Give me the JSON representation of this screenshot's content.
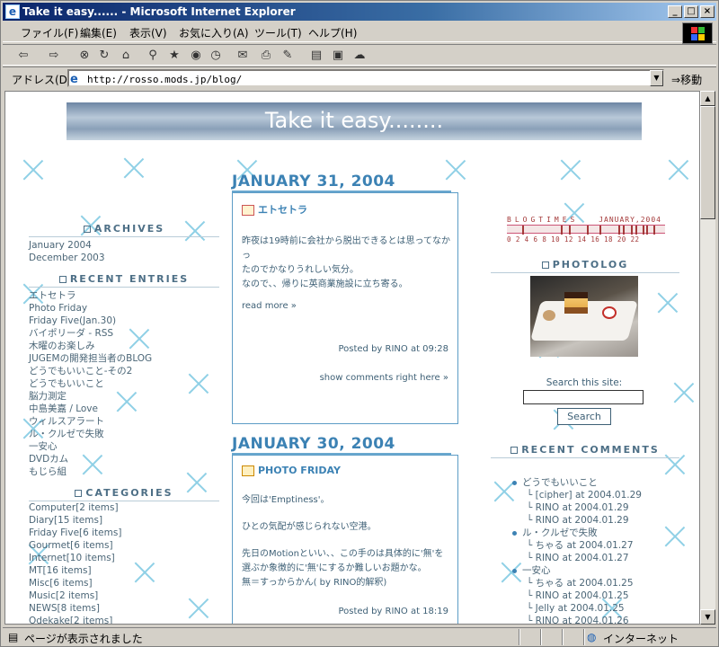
{
  "window": {
    "title": "Take it easy...... - Microsoft Internet Explorer"
  },
  "menu": [
    "ファイル(F)",
    "編集(E)",
    "表示(V)",
    "お気に入り(A)",
    "ツール(T)",
    "ヘルプ(H)"
  ],
  "address": {
    "label": "アドレス(D)",
    "url": "http://rosso.mods.jp/blog/",
    "go": "移動"
  },
  "status": {
    "text": "ページが表示されました",
    "zone": "インターネット"
  },
  "blog": {
    "title": "Take it easy........"
  },
  "sidebar_left": {
    "archives_title": "ARCHIVES",
    "archives": [
      "January 2004",
      "December 2003"
    ],
    "recent_title": "RECENT ENTRIES",
    "recent": [
      "エトセトラ",
      "Photo Friday",
      "Friday Five(Jan.30)",
      "バイポリーダ - RSS",
      "木曜のお楽しみ",
      "JUGEMの開発担当者のBLOG",
      "どうでもいいこと-その2",
      "どうでもいいこと",
      "脳力測定",
      "中島美嘉 / Love",
      "ウィルスアラート",
      "ル・クルゼで失敗",
      "一安心",
      "DVDカム",
      "もじら組"
    ],
    "categories_title": "CATEGORIES",
    "categories": [
      "Computer[2 items]",
      "Diary[15 items]",
      "Friday Five[6 items]",
      "Gourmet[6 items]",
      "Internet[10 items]",
      "MT[16 items]",
      "Misc[6 items]",
      "Music[2 items]",
      "NEWS[8 items]",
      "Odekake[2 items]"
    ]
  },
  "entries": [
    {
      "date": "JANUARY 31, 2004",
      "title": "エトセトラ",
      "body": [
        "昨夜は19時前に会社から脱出できるとは思ってなかっ",
        "たのでかなりうれしい気分。",
        "なので、、帰りに英商業施設に立ち寄る。"
      ],
      "readmore": "read more »",
      "posted": "Posted by RINO at 09:28",
      "comments": "show comments right here »"
    },
    {
      "date": "JANUARY 30, 2004",
      "title": "PHOTO FRIDAY",
      "body": [
        "今回は'Emptiness'。",
        "",
        "ひとの気配が感じられない空港。",
        "",
        "先日のMotionといい、、この手のは具体的に'無'を",
        "選ぶか象徴的に'無'にするか難しいお題かな。",
        "無＝すっからかん( by RINO的解釈)"
      ],
      "posted": "Posted by RINO at 18:19"
    }
  ],
  "sidebar_right": {
    "blogtimes_title": "BLOGTIMES",
    "blogtimes_month": "JANUARY,2004",
    "blogtimes_axis": "0  2  4  6  8  10 12 14 16 18 20 22",
    "blogtimes_posts": [
      0.1,
      0.35,
      0.4,
      0.52,
      0.6,
      0.72,
      0.75,
      0.8,
      0.83,
      0.88,
      0.9,
      0.95
    ],
    "photolog_title": "PHOTOLOG",
    "search_label": "Search this site:",
    "search_button": "Search",
    "recent_comments_title": "RECENT COMMENTS",
    "recent_comments": [
      {
        "entry": "どうでもいいこと",
        "comments": [
          "[cipher] at 2004.01.29",
          "RINO at 2004.01.29",
          "RINO at 2004.01.29"
        ]
      },
      {
        "entry": "ル・クルゼで失敗",
        "comments": [
          "ちゃる at 2004.01.27",
          "RINO at 2004.01.27"
        ]
      },
      {
        "entry": "一安心",
        "comments": [
          "ちゃる at 2004.01.25",
          "RINO at 2004.01.25",
          "Jelly at 2004.01.25",
          "RINO at 2004.01.26"
        ]
      }
    ]
  }
}
